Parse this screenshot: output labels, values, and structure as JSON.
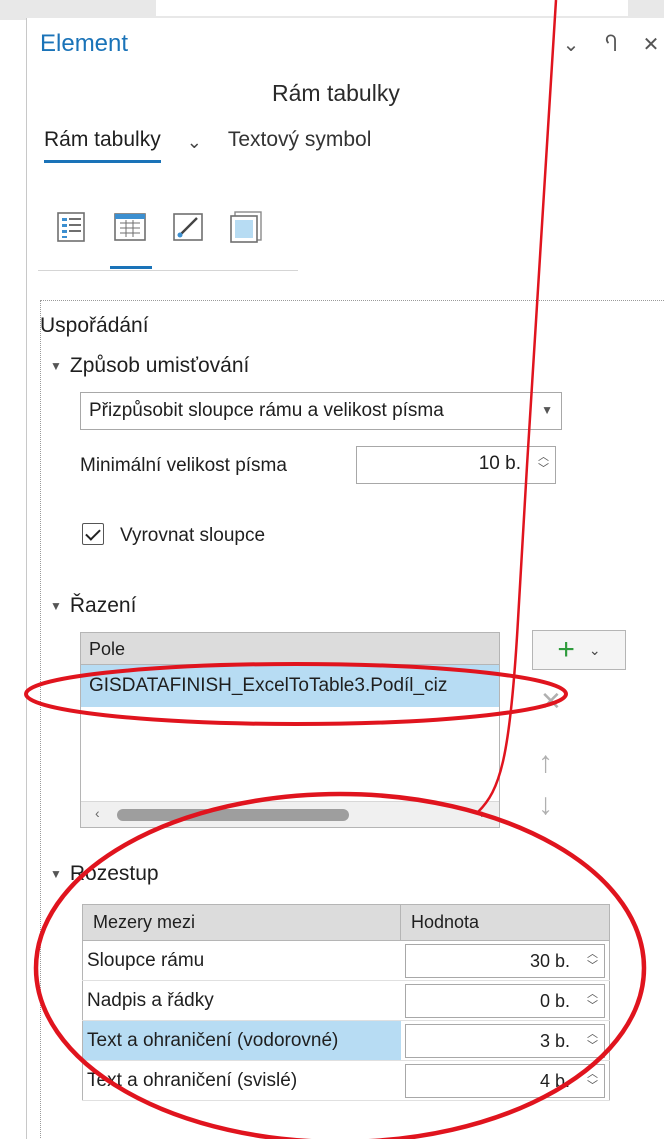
{
  "pane": {
    "title": "Element",
    "subtitle": "Rám tabulky",
    "controls": [
      "⌄",
      "Ⴄ",
      "✕"
    ]
  },
  "tabs": {
    "active": "Rám tabulky",
    "other": "Textový symbol"
  },
  "toolbar_icons": [
    "options-icon",
    "table-frame-icon",
    "symbol-brush-icon",
    "display-icon"
  ],
  "section": {
    "title": "Uspořádání",
    "placement": {
      "title": "Způsob umisťování",
      "mode": "Přizpůsobit sloupce rámu a velikost písma",
      "min_font_label": "Minimální velikost písma",
      "min_font_value": "10 b.",
      "align_label": "Vyrovnat sloupce",
      "align_checked": true
    },
    "sort": {
      "title": "Řazení",
      "column": "Pole",
      "rows": [
        "GISDATAFINISH_ExcelToTable3.Podíl_ciz"
      ]
    },
    "spacing": {
      "title": "Rozestup",
      "col_name": "Mezery mezi",
      "col_value": "Hodnota",
      "rows": [
        {
          "name": "Sloupce rámu",
          "value": "30 b."
        },
        {
          "name": "Nadpis a řádky",
          "value": "0 b."
        },
        {
          "name": "Text a ohraničení (vodorovné)",
          "value": "3 b."
        },
        {
          "name": "Text a ohraničení (svislé)",
          "value": "4 b."
        }
      ]
    }
  },
  "colors": {
    "accent": "#1a73b8",
    "selection": "#b7dcf3",
    "annotation_red": "#e0141e"
  }
}
